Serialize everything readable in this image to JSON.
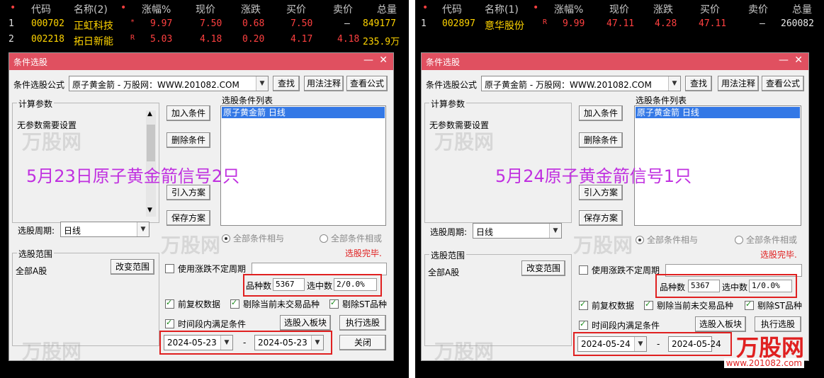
{
  "panels": [
    {
      "quote": {
        "headers": {
          "dot": "•",
          "code": "代码",
          "name": "名称(2)",
          "dot2": "•",
          "pct": "涨幅%",
          "price": "现价",
          "chg": "涨跌",
          "bid": "买价",
          "ask": "卖价",
          "vol": "总量"
        },
        "rows": [
          {
            "idx": "1",
            "code": "000702",
            "name": "正虹科技",
            "mark": "*",
            "pct": "9.97",
            "price": "7.50",
            "chg": "0.68",
            "bid": "7.50",
            "ask": "—",
            "vol": "849177"
          },
          {
            "idx": "2",
            "code": "002218",
            "name": "拓日新能",
            "mark": "R",
            "pct": "5.03",
            "price": "4.18",
            "chg": "0.20",
            "bid": "4.17",
            "ask": "4.18",
            "vol": "235.9万"
          }
        ]
      },
      "dialog": {
        "title": "条件选股",
        "formula_label": "条件选股公式",
        "formula_value": "原子黄金箭 - 万股网：WWW.201082.COM",
        "search_btn": "查找",
        "usage_btn": "用法注释",
        "view_btn": "查看公式",
        "params_group": "计算参数",
        "params_text": "无参数需要设置",
        "add_btn": "加入条件",
        "del_btn": "删除条件",
        "import_btn": "引入方案",
        "save_btn": "保存方案",
        "list_label": "选股条件列表",
        "list_item": "原子黄金箭 日线",
        "period_label": "选股周期:",
        "period_value": "日线",
        "radio_and": "全部条件相与",
        "radio_or": "全部条件相或",
        "done_text": "选股完毕.",
        "range_group": "选股范围",
        "range_value": "全部A股",
        "change_range_btn": "改变范围",
        "use_chk": "使用涨跌不定周期",
        "count_label": "品种数",
        "count_value": "5367",
        "sel_label": "选中数",
        "sel_value": "2/0.0%",
        "chk_fq": "前复权数据",
        "chk_untraded": "剔除当前未交易品种",
        "chk_st": "剔除ST品种",
        "chk_time": "时间段内满足条件",
        "board_btn": "选股入板块",
        "exec_btn": "执行选股",
        "date_from": "2024-05-23",
        "date_to": "2024-05-23",
        "dash": "-",
        "close_btn": "关闭"
      },
      "banner": "5月23日原子黄金箭信号2只"
    },
    {
      "quote": {
        "headers": {
          "dot": "•",
          "code": "代码",
          "name": "名称(1)",
          "dot2": "•",
          "pct": "涨幅%",
          "price": "现价",
          "chg": "涨跌",
          "bid": "买价",
          "ask": "卖价",
          "vol": "总量"
        },
        "rows": [
          {
            "idx": "1",
            "code": "002897",
            "name": "意华股份",
            "mark": "R",
            "pct": "9.99",
            "price": "47.11",
            "chg": "4.28",
            "bid": "47.11",
            "ask": "—",
            "vol": "260082"
          }
        ]
      },
      "dialog": {
        "title": "条件选股",
        "formula_label": "条件选股公式",
        "formula_value": "原子黄金箭 - 万股网：WWW.201082.COM",
        "search_btn": "查找",
        "usage_btn": "用法注释",
        "view_btn": "查看公式",
        "params_group": "计算参数",
        "params_text": "无参数需要设置",
        "add_btn": "加入条件",
        "del_btn": "删除条件",
        "import_btn": "引入方案",
        "save_btn": "保存方案",
        "list_label": "选股条件列表",
        "list_item": "原子黄金箭 日线",
        "period_label": "选股周期:",
        "period_value": "日线",
        "radio_and": "全部条件相与",
        "radio_or": "全部条件相或",
        "done_text": "选股完毕.",
        "range_group": "选股范围",
        "range_value": "全部A股",
        "change_range_btn": "改变范围",
        "use_chk": "使用涨跌不定周期",
        "count_label": "品种数",
        "count_value": "5367",
        "sel_label": "选中数",
        "sel_value": "1/0.0%",
        "chk_fq": "前复权数据",
        "chk_untraded": "剔除当前未交易品种",
        "chk_st": "剔除ST品种",
        "chk_time": "时间段内满足条件",
        "board_btn": "选股入板块",
        "exec_btn": "执行选股",
        "date_from": "2024-05-24",
        "date_to": "2024-05-24",
        "dash": "-"
      },
      "banner": "5月24原子黄金箭信号1只"
    }
  ],
  "watermark": {
    "text": "万股网"
  },
  "logo": {
    "text": "万股网",
    "url": "www.201082.com"
  },
  "colors": {
    "title_bar": "#e05060",
    "highlight_box": "#e02020",
    "banner": "#c030e0",
    "quote_up": "#ff4040",
    "quote_code": "#ffd400"
  }
}
